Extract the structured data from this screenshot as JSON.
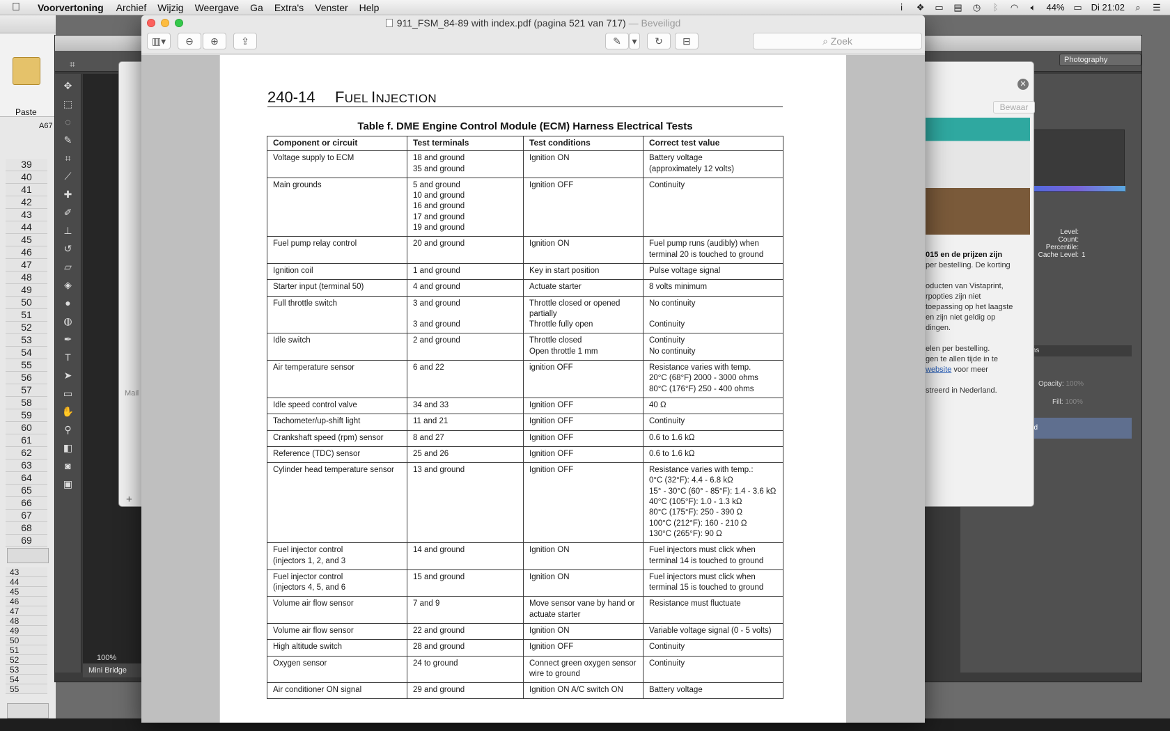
{
  "menubar": {
    "apple": "",
    "app": "Voorvertoning",
    "items": [
      "Archief",
      "Wijzig",
      "Weergave",
      "Ga",
      "Extra's",
      "Venster",
      "Help"
    ],
    "battery": "44%",
    "clock": "Di 21:02"
  },
  "excel": {
    "paste_label": "Paste",
    "cell_ref": "A67",
    "rows": [
      "39",
      "40",
      "41",
      "42",
      "43",
      "44",
      "45",
      "46",
      "47",
      "48",
      "49",
      "50",
      "51",
      "52",
      "53",
      "54",
      "55",
      "56",
      "57",
      "58",
      "59",
      "60",
      "61",
      "62",
      "63",
      "64",
      "65",
      "66",
      "67",
      "68",
      "69"
    ],
    "rows2": [
      "43",
      "44",
      "45",
      "46",
      "47",
      "48",
      "49",
      "50",
      "51",
      "52",
      "53",
      "54",
      "55"
    ]
  },
  "photoshop": {
    "workspace": "Photography",
    "zoom": "100%",
    "mini_bridge": "Mini Bridge",
    "stats_labels": [
      "Level:",
      "Count:",
      "Percentile:",
      "Cache Level:"
    ],
    "cache_level": "1",
    "opacity_label": "Opacity:",
    "opacity_value": "100%",
    "fill_label": "Fill:",
    "fill_value": "100%",
    "paths_tab": "ths"
  },
  "mail": {
    "save_button": "Bewaar",
    "label": "Mail",
    "text_bold": "015 en de prijzen zijn",
    "text_lines": [
      "per bestelling. De korting",
      "",
      "oducten van Vistaprint,",
      "rpopties zijn niet",
      "toepassing op het laagste",
      "en zijn niet geldig op",
      "dingen.",
      "",
      "elen per bestelling.",
      "gen te allen tijde in te"
    ],
    "link_text": "website",
    "link_suffix": " voor meer",
    "footer_text": "streerd in Nederland."
  },
  "preview": {
    "title": "911_FSM_84-89 with index.pdf (pagina 521 van 717)",
    "secured": "— Beveiligd",
    "search_placeholder": "Zoek"
  },
  "pdf": {
    "page_number": "240-14",
    "section_title_first": "F",
    "section_title_rest": "UEL ",
    "section_title_first2": "I",
    "section_title_rest2": "NJECTION",
    "table_title": "Table f. DME Engine Control Module (ECM) Harness Electrical Tests",
    "columns": [
      "Component or circuit",
      "Test terminals",
      "Test conditions",
      "Correct test value"
    ],
    "rows": [
      {
        "component": [
          "Voltage supply to ECM"
        ],
        "terminals": [
          "18 and ground",
          "35 and ground"
        ],
        "conditions": [
          "Ignition ON"
        ],
        "value": [
          "Battery voltage",
          "(approximately 12 volts)"
        ]
      },
      {
        "component": [
          "Main grounds"
        ],
        "terminals": [
          "5 and ground",
          "10 and ground",
          "16 and ground",
          "17 and ground",
          "19 and ground"
        ],
        "conditions": [
          "Ignition OFF"
        ],
        "value": [
          "Continuity"
        ]
      },
      {
        "component": [
          "Fuel pump relay control"
        ],
        "terminals": [
          "20 and ground"
        ],
        "conditions": [
          "Ignition ON"
        ],
        "value": [
          "Fuel pump runs (audibly) when",
          "terminal 20 is touched to ground"
        ]
      },
      {
        "component": [
          "Ignition coil"
        ],
        "terminals": [
          "1 and ground"
        ],
        "conditions": [
          "Key in start position"
        ],
        "value": [
          "Pulse voltage signal"
        ]
      },
      {
        "component": [
          "Starter input (terminal 50)"
        ],
        "terminals": [
          "4 and ground"
        ],
        "conditions": [
          "Actuate starter"
        ],
        "value": [
          "8 volts minimum"
        ]
      },
      {
        "component": [
          "Full throttle switch"
        ],
        "terminals": [
          "3 and ground",
          "",
          "3 and ground"
        ],
        "conditions": [
          "Throttle closed or opened",
          "partially",
          "Throttle fully open"
        ],
        "value": [
          "No continuity",
          "",
          "Continuity"
        ]
      },
      {
        "component": [
          "Idle switch"
        ],
        "terminals": [
          "2 and ground"
        ],
        "conditions": [
          "Throttle closed",
          "Open throttle 1 mm"
        ],
        "value": [
          "Continuity",
          "No continuity"
        ]
      },
      {
        "component": [
          "Air temperature sensor"
        ],
        "terminals": [
          "6 and 22"
        ],
        "conditions": [
          "ignition OFF"
        ],
        "value": [
          "Resistance varies with temp.",
          "20°C (68°F) 2000 - 3000 ohms",
          "80°C (176°F) 250 - 400 ohms"
        ]
      },
      {
        "component": [
          "Idle speed control valve"
        ],
        "terminals": [
          "34 and 33"
        ],
        "conditions": [
          "Ignition OFF"
        ],
        "value": [
          "40 Ω"
        ]
      },
      {
        "component": [
          "Tachometer/up-shift light"
        ],
        "terminals": [
          "11 and 21"
        ],
        "conditions": [
          "Ignition OFF"
        ],
        "value": [
          "Continuity"
        ]
      },
      {
        "component": [
          "Crankshaft speed (rpm) sensor"
        ],
        "terminals": [
          "8 and 27"
        ],
        "conditions": [
          "Ignition OFF"
        ],
        "value": [
          "0.6 to 1.6 kΩ"
        ]
      },
      {
        "component": [
          "Reference (TDC) sensor"
        ],
        "terminals": [
          "25 and 26"
        ],
        "conditions": [
          "Ignition OFF"
        ],
        "value": [
          "0.6 to 1.6 kΩ"
        ]
      },
      {
        "component": [
          "Cylinder head temperature sensor"
        ],
        "terminals": [
          "13 and ground"
        ],
        "conditions": [
          "Ignition OFF"
        ],
        "value": [
          "Resistance varies with temp.:",
          "0°C (32°F): 4.4 - 6.8 kΩ",
          "15° - 30°C (60° - 85°F): 1.4 - 3.6 kΩ",
          "40°C (105°F): 1.0 - 1.3 kΩ",
          "80°C (175°F): 250 - 390 Ω",
          "100°C (212°F): 160 - 210 Ω",
          "130°C (265°F): 90 Ω"
        ]
      },
      {
        "component": [
          "Fuel injector control",
          "(injectors 1, 2, and 3"
        ],
        "terminals": [
          "14 and ground"
        ],
        "conditions": [
          "Ignition ON"
        ],
        "value": [
          "Fuel injectors must click when",
          "terminal 14 is touched to ground"
        ]
      },
      {
        "component": [
          "Fuel injector control",
          "(injectors 4, 5, and 6"
        ],
        "terminals": [
          "15 and ground"
        ],
        "conditions": [
          "Ignition ON"
        ],
        "value": [
          "Fuel injectors must click when",
          "terminal 15 is touched to ground"
        ]
      },
      {
        "component": [
          "Volume air flow sensor"
        ],
        "terminals": [
          "7 and 9"
        ],
        "conditions": [
          "Move sensor vane by hand or",
          "actuate starter"
        ],
        "value": [
          "Resistance must fluctuate"
        ]
      },
      {
        "component": [
          "Volume air flow sensor"
        ],
        "terminals": [
          "22 and ground"
        ],
        "conditions": [
          "Ignition ON"
        ],
        "value": [
          "Variable voltage signal (0 - 5 volts)"
        ]
      },
      {
        "component": [
          "High altitude switch"
        ],
        "terminals": [
          "28 and ground"
        ],
        "conditions": [
          "Ignition OFF"
        ],
        "value": [
          "Continuity"
        ]
      },
      {
        "component": [
          "Oxygen sensor"
        ],
        "terminals": [
          "24 to ground"
        ],
        "conditions": [
          "Connect green oxygen sensor",
          "wire to ground"
        ],
        "value": [
          "Continuity"
        ]
      },
      {
        "component": [
          "Air conditioner ON signal"
        ],
        "terminals": [
          "29 and ground"
        ],
        "conditions": [
          "Ignition ON A/C switch ON"
        ],
        "value": [
          "Battery voltage"
        ]
      }
    ]
  }
}
